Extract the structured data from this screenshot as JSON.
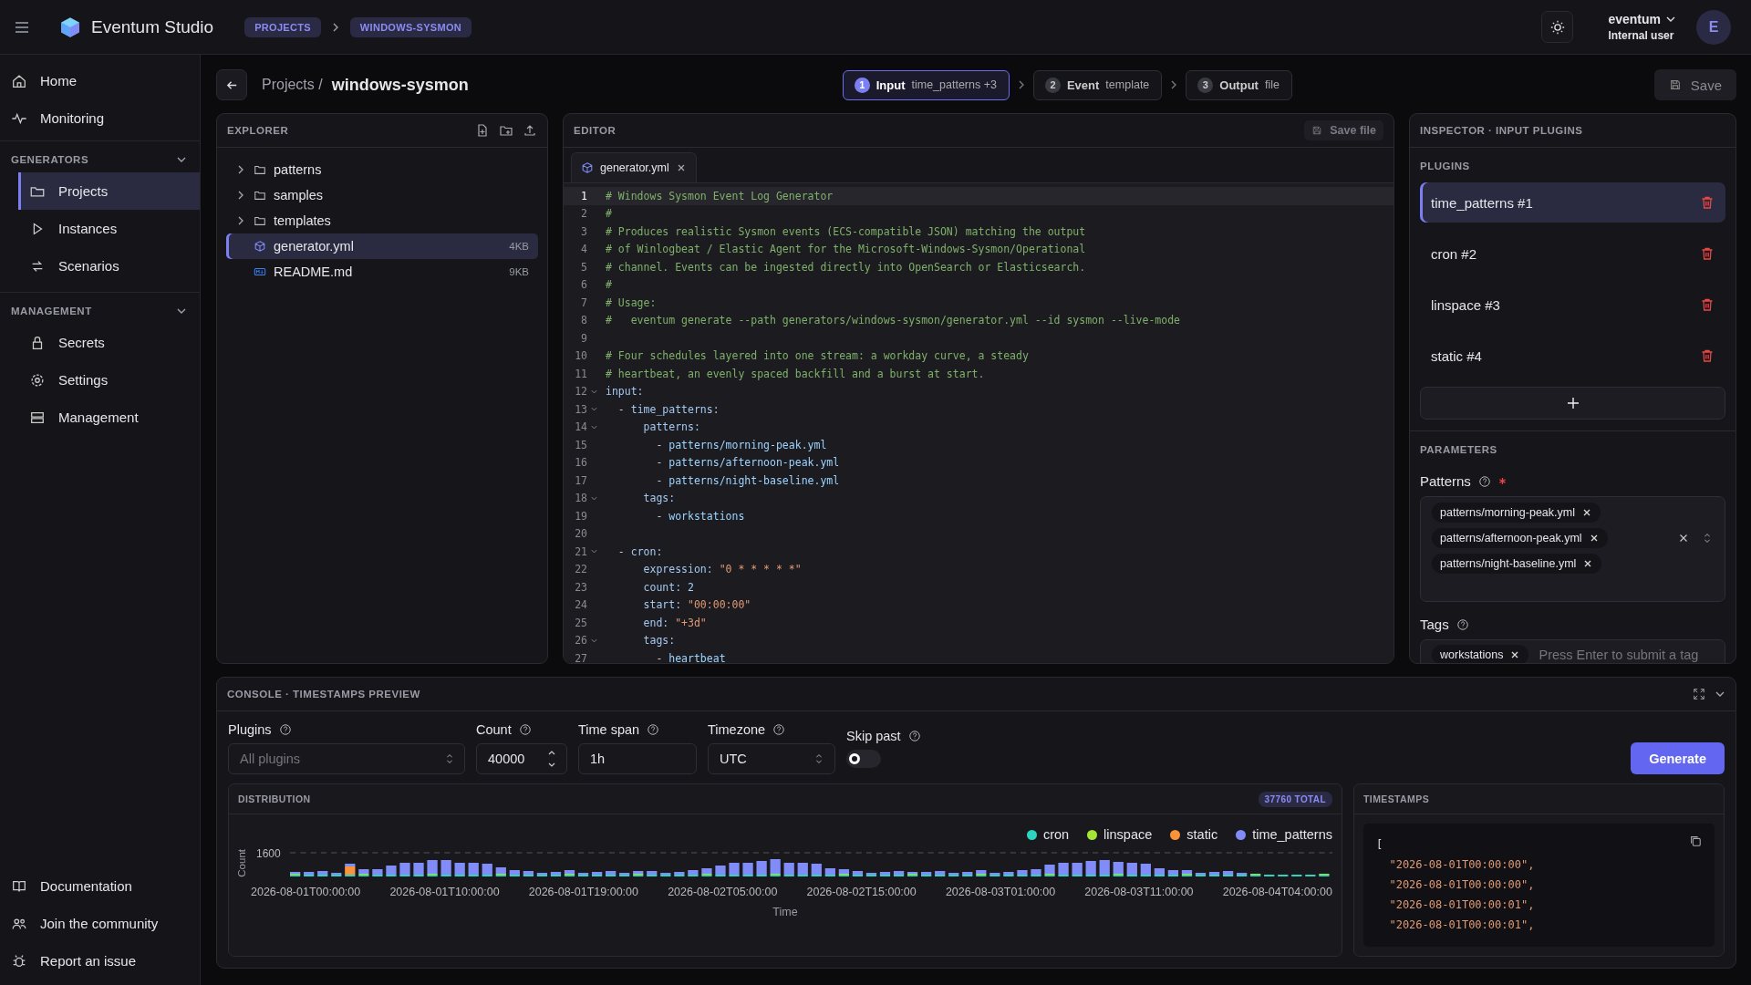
{
  "app": {
    "name": "Eventum Studio"
  },
  "breadcrumb": [
    {
      "label": "PROJECTS"
    },
    {
      "label": "WINDOWS-SYSMON"
    }
  ],
  "user": {
    "name": "eventum",
    "role": "Internal user",
    "initial": "E"
  },
  "sidebar": {
    "top": [
      {
        "label": "Home",
        "selected": false
      },
      {
        "label": "Monitoring",
        "selected": false
      }
    ],
    "sections": [
      {
        "title": "GENERATORS",
        "items": [
          {
            "label": "Projects",
            "selected": true
          },
          {
            "label": "Instances",
            "selected": false
          },
          {
            "label": "Scenarios",
            "selected": false
          }
        ]
      },
      {
        "title": "MANAGEMENT",
        "items": [
          {
            "label": "Secrets",
            "selected": false
          },
          {
            "label": "Settings",
            "selected": false
          },
          {
            "label": "Management",
            "selected": false
          }
        ]
      }
    ],
    "bottom": [
      {
        "label": "Documentation"
      },
      {
        "label": "Join the community"
      },
      {
        "label": "Report an issue"
      }
    ]
  },
  "page": {
    "parent": "Projects /",
    "title": "windows-sysmon",
    "save": "Save"
  },
  "steps": [
    {
      "num": "1",
      "label": "Input",
      "detail": "time_patterns +3",
      "selected": true
    },
    {
      "num": "2",
      "label": "Event",
      "detail": "template",
      "selected": false
    },
    {
      "num": "3",
      "label": "Output",
      "detail": "file",
      "selected": false
    }
  ],
  "explorer": {
    "title": "EXPLORER",
    "items": [
      {
        "kind": "folder",
        "name": "patterns",
        "selected": false
      },
      {
        "kind": "folder",
        "name": "samples",
        "selected": false
      },
      {
        "kind": "folder",
        "name": "templates",
        "selected": false
      },
      {
        "kind": "yaml",
        "name": "generator.yml",
        "size": "4KB",
        "selected": true
      },
      {
        "kind": "markdown",
        "name": "README.md",
        "size": "9KB",
        "selected": false
      }
    ]
  },
  "editor": {
    "title": "EDITOR",
    "save": "Save file",
    "tab": "generator.yml",
    "lines": [
      {
        "n": "1",
        "current": true,
        "fold": false,
        "parts": [
          {
            "kind": "comment",
            "text": "# Windows Sysmon Event Log Generator"
          }
        ]
      },
      {
        "n": "2",
        "current": false,
        "fold": false,
        "parts": [
          {
            "kind": "comment",
            "text": "#"
          }
        ]
      },
      {
        "n": "3",
        "current": false,
        "fold": false,
        "parts": [
          {
            "kind": "comment",
            "text": "# Produces realistic Sysmon events (ECS-compatible JSON) matching the output"
          }
        ]
      },
      {
        "n": "4",
        "current": false,
        "fold": false,
        "parts": [
          {
            "kind": "comment",
            "text": "# of Winlogbeat / Elastic Agent for the Microsoft-Windows-Sysmon/Operational"
          }
        ]
      },
      {
        "n": "5",
        "current": false,
        "fold": false,
        "parts": [
          {
            "kind": "comment",
            "text": "# channel. Events can be ingested directly into OpenSearch or Elasticsearch."
          }
        ]
      },
      {
        "n": "6",
        "current": false,
        "fold": false,
        "parts": [
          {
            "kind": "comment",
            "text": "#"
          }
        ]
      },
      {
        "n": "7",
        "current": false,
        "fold": false,
        "parts": [
          {
            "kind": "comment",
            "text": "# Usage:"
          }
        ]
      },
      {
        "n": "8",
        "current": false,
        "fold": false,
        "parts": [
          {
            "kind": "comment",
            "text": "#   eventum generate --path generators/windows-sysmon/generator.yml --id sysmon --live-mode"
          }
        ]
      },
      {
        "n": "9",
        "current": false,
        "fold": false
      },
      {
        "n": "10",
        "current": false,
        "fold": false,
        "parts": [
          {
            "kind": "comment",
            "text": "# Four schedules layered into one stream: a workday curve, a steady"
          }
        ]
      },
      {
        "n": "11",
        "current": false,
        "fold": false,
        "parts": [
          {
            "kind": "comment",
            "text": "# heartbeat, an evenly spaced backfill and a burst at start."
          }
        ]
      },
      {
        "n": "12",
        "current": false,
        "fold": true,
        "parts": [
          {
            "kind": "key",
            "text": "input:"
          }
        ]
      },
      {
        "n": "13",
        "current": false,
        "fold": true,
        "parts": [
          {
            "kind": "plain",
            "text": "  - "
          },
          {
            "kind": "key",
            "text": "time_patterns:"
          }
        ]
      },
      {
        "n": "14",
        "current": false,
        "fold": true,
        "parts": [
          {
            "kind": "key",
            "text": "      patterns:"
          }
        ]
      },
      {
        "n": "15",
        "current": false,
        "fold": false,
        "parts": [
          {
            "kind": "plain",
            "text": "        - "
          },
          {
            "kind": "value",
            "text": "patterns/morning-peak.yml"
          }
        ]
      },
      {
        "n": "16",
        "current": false,
        "fold": false,
        "parts": [
          {
            "kind": "plain",
            "text": "        - "
          },
          {
            "kind": "value",
            "text": "patterns/afternoon-peak.yml"
          }
        ]
      },
      {
        "n": "17",
        "current": false,
        "fold": false,
        "parts": [
          {
            "kind": "plain",
            "text": "        - "
          },
          {
            "kind": "value",
            "text": "patterns/night-baseline.yml"
          }
        ]
      },
      {
        "n": "18",
        "current": false,
        "fold": true,
        "parts": [
          {
            "kind": "key",
            "text": "      tags:"
          }
        ]
      },
      {
        "n": "19",
        "current": false,
        "fold": false,
        "parts": [
          {
            "kind": "plain",
            "text": "        - "
          },
          {
            "kind": "value",
            "text": "workstations"
          }
        ]
      },
      {
        "n": "20",
        "current": false,
        "fold": false
      },
      {
        "n": "21",
        "current": false,
        "fold": true,
        "parts": [
          {
            "kind": "plain",
            "text": "  - "
          },
          {
            "kind": "key",
            "text": "cron:"
          }
        ]
      },
      {
        "n": "22",
        "current": false,
        "fold": false,
        "parts": [
          {
            "kind": "key",
            "text": "      expression: "
          },
          {
            "kind": "string",
            "text": "\"0 * * * * *\""
          }
        ]
      },
      {
        "n": "23",
        "current": false,
        "fold": false,
        "parts": [
          {
            "kind": "key",
            "text": "      count: "
          },
          {
            "kind": "value",
            "text": "2"
          }
        ]
      },
      {
        "n": "24",
        "current": false,
        "fold": false,
        "parts": [
          {
            "kind": "key",
            "text": "      start: "
          },
          {
            "kind": "string",
            "text": "\"00:00:00\""
          }
        ]
      },
      {
        "n": "25",
        "current": false,
        "fold": false,
        "parts": [
          {
            "kind": "key",
            "text": "      end: "
          },
          {
            "kind": "string",
            "text": "\"+3d\""
          }
        ]
      },
      {
        "n": "26",
        "current": false,
        "fold": true,
        "parts": [
          {
            "kind": "key",
            "text": "      tags:"
          }
        ]
      },
      {
        "n": "27",
        "current": false,
        "fold": false,
        "parts": [
          {
            "kind": "plain",
            "text": "        - "
          },
          {
            "kind": "value",
            "text": "heartbeat"
          }
        ]
      }
    ]
  },
  "inspector": {
    "title": "INSPECTOR · INPUT PLUGINS",
    "plugins_title": "PLUGINS",
    "plugins": [
      {
        "name": "time_patterns #1",
        "selected": true
      },
      {
        "name": "cron #2",
        "selected": false
      },
      {
        "name": "linspace #3",
        "selected": false
      },
      {
        "name": "static #4",
        "selected": false
      }
    ],
    "parameters_title": "PARAMETERS",
    "patterns": {
      "label": "Patterns",
      "required": true,
      "chips": [
        "patterns/morning-peak.yml",
        "patterns/afternoon-peak.yml",
        "patterns/night-baseline.yml"
      ]
    },
    "tags": {
      "label": "Tags",
      "chips": [
        "workstations"
      ],
      "placeholder": "Press Enter to submit a tag"
    }
  },
  "console": {
    "title": "CONSOLE · TIMESTAMPS PREVIEW",
    "plugins": {
      "label": "Plugins",
      "placeholder": "All plugins"
    },
    "count": {
      "label": "Count",
      "value": "40000"
    },
    "time_span": {
      "label": "Time span",
      "value": "1h"
    },
    "timezone": {
      "label": "Timezone",
      "value": "UTC"
    },
    "skip_past": {
      "label": "Skip past",
      "on": false
    },
    "generate": "Generate",
    "distribution": {
      "title": "DISTRIBUTION",
      "total": "37760 TOTAL",
      "legend": [
        {
          "name": "cron",
          "color": "#2dd4bf"
        },
        {
          "name": "linspace",
          "color": "#a3e635"
        },
        {
          "name": "static",
          "color": "#fb923c"
        },
        {
          "name": "time_patterns",
          "color": "#818cf8"
        }
      ],
      "ylabel": "Count",
      "ytick": "1600",
      "xlabel": "Time",
      "xticks": [
        "2026-08-01T00:00:00",
        "2026-08-01T10:00:00",
        "2026-08-01T19:00:00",
        "2026-08-02T05:00:00",
        "2026-08-02T15:00:00",
        "2026-08-03T01:00:00",
        "2026-08-03T11:00:00",
        "2026-08-04T04:00:00"
      ]
    },
    "timestamps": {
      "title": "TIMESTAMPS",
      "lines": [
        "[",
        "  \"2026-08-01T00:00:00\",",
        "  \"2026-08-01T00:00:00\",",
        "  \"2026-08-01T00:00:01\",",
        "  \"2026-08-01T00:00:01\","
      ]
    }
  }
}
